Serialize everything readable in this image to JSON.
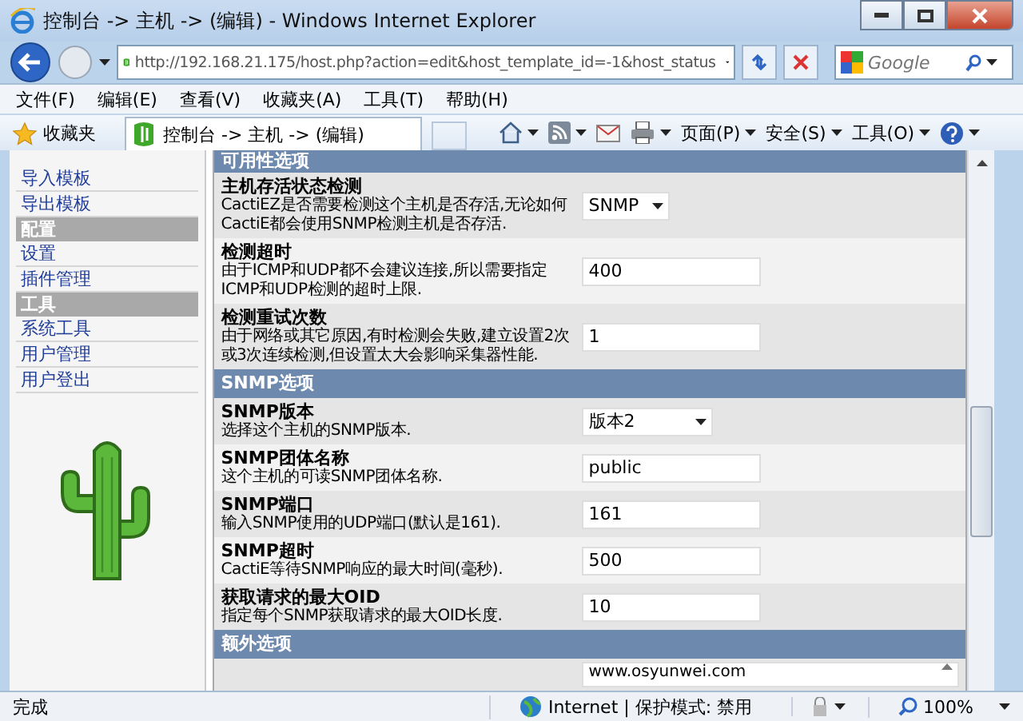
{
  "window": {
    "title": "控制台 -> 主机 -> (编辑) - Windows Internet Explorer"
  },
  "address_bar": {
    "url": "http://192.168.21.175/host.php?action=edit&host_template_id=-1&host_status"
  },
  "search": {
    "placeholder": "Google"
  },
  "menu": [
    "文件(F)",
    "编辑(E)",
    "查看(V)",
    "收藏夹(A)",
    "工具(T)",
    "帮助(H)"
  ],
  "favorites": {
    "label": "收藏夹"
  },
  "tab": {
    "title": "控制台 -> 主机 -> (编辑)"
  },
  "command_bar": [
    "页面(P)",
    "安全(S)",
    "工具(O)"
  ],
  "sidebar": {
    "items": [
      {
        "kind": "link",
        "label": "导入模板"
      },
      {
        "kind": "link",
        "label": "导出模板"
      },
      {
        "kind": "header",
        "label": "配置"
      },
      {
        "kind": "link",
        "label": "设置"
      },
      {
        "kind": "link",
        "label": "插件管理"
      },
      {
        "kind": "header",
        "label": "工具"
      },
      {
        "kind": "link",
        "label": "系统工具"
      },
      {
        "kind": "link",
        "label": "用户管理"
      },
      {
        "kind": "link",
        "label": "用户登出"
      }
    ]
  },
  "form": {
    "sections": [
      {
        "title": "可用性选项",
        "rows": [
          {
            "kind": "select",
            "label": "主机存活状态检测",
            "description": "CactiEZ是否需要检测这个主机是否存活,无论如何CactiE都会使用SNMP检测主机是否存活.",
            "value": "SNMP"
          },
          {
            "kind": "text",
            "label": "检测超时",
            "description": "由于ICMP和UDP都不会建议连接,所以需要指定ICMP和UDP检测的超时上限.",
            "value": "400"
          },
          {
            "kind": "text",
            "label": "检测重试次数",
            "description": "由于网络或其它原因,有时检测会失败,建立设置2次或3次连续检测,但设置太大会影响采集器性能.",
            "value": "1"
          }
        ]
      },
      {
        "title": "SNMP选项",
        "rows": [
          {
            "kind": "select",
            "label": "SNMP版本",
            "description": "选择这个主机的SNMP版本.",
            "value": "版本2"
          },
          {
            "kind": "text",
            "label": "SNMP团体名称",
            "description": "这个主机的可读SNMP团体名称.",
            "value": "public"
          },
          {
            "kind": "text",
            "label": "SNMP端口",
            "description": "输入SNMP使用的UDP端口(默认是161).",
            "value": "161"
          },
          {
            "kind": "text",
            "label": "SNMP超时",
            "description": "CactiE等待SNMP响应的最大时间(毫秒).",
            "value": "500"
          },
          {
            "kind": "text",
            "label": "获取请求的最大OID",
            "description": "指定每个SNMP获取请求的最大OID长度.",
            "value": "10"
          }
        ]
      },
      {
        "title": "额外选项",
        "rows": [
          {
            "kind": "textarea",
            "value": "www.osyunwei.com"
          }
        ]
      }
    ]
  },
  "status_bar": {
    "text": "完成",
    "zone": "Internet | 保护模式: 禁用",
    "zoom": "100%"
  }
}
